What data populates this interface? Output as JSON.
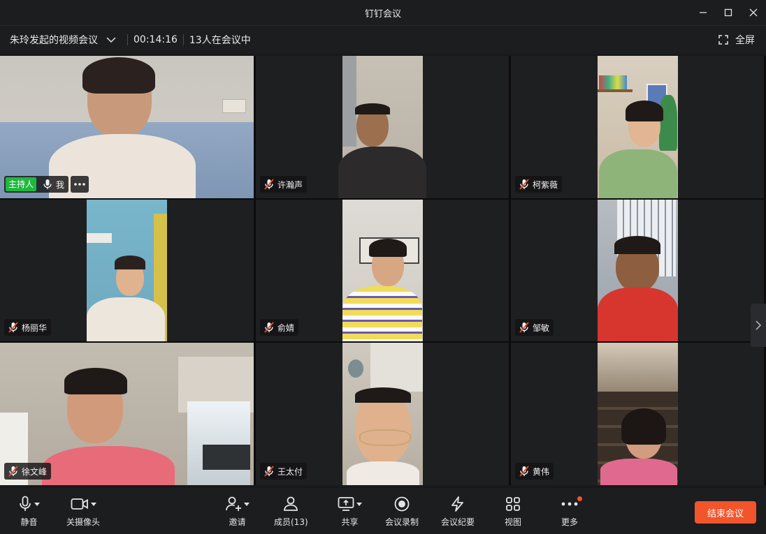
{
  "window": {
    "title": "钉钉会议"
  },
  "meeting": {
    "title": "朱玲发起的视频会议",
    "duration": "00:14:16",
    "participants_text": "13人在会议中",
    "fullscreen_label": "全屏"
  },
  "tiles": [
    {
      "name": "我",
      "host_label": "主持人",
      "muted": false
    },
    {
      "name": "许瀚声",
      "muted": true
    },
    {
      "name": "柯紫薇",
      "muted": true
    },
    {
      "name": "杨丽华",
      "muted": true
    },
    {
      "name": "俞婧",
      "muted": true
    },
    {
      "name": "邹敏",
      "muted": true
    },
    {
      "name": "徐文峰",
      "muted": true
    },
    {
      "name": "王太付",
      "muted": true
    },
    {
      "name": "黄伟",
      "muted": true
    }
  ],
  "toolbar": {
    "mute": "静音",
    "camera": "关摄像头",
    "invite": "邀请",
    "members": "成员(13)",
    "share": "共享",
    "record": "会议录制",
    "minutes": "会议纪要",
    "view": "视图",
    "more": "更多",
    "end": "结束会议"
  },
  "colors": {
    "accent_end": "#f2552c",
    "host_badge": "#1fb83f",
    "mute_slash": "#e8502a"
  }
}
